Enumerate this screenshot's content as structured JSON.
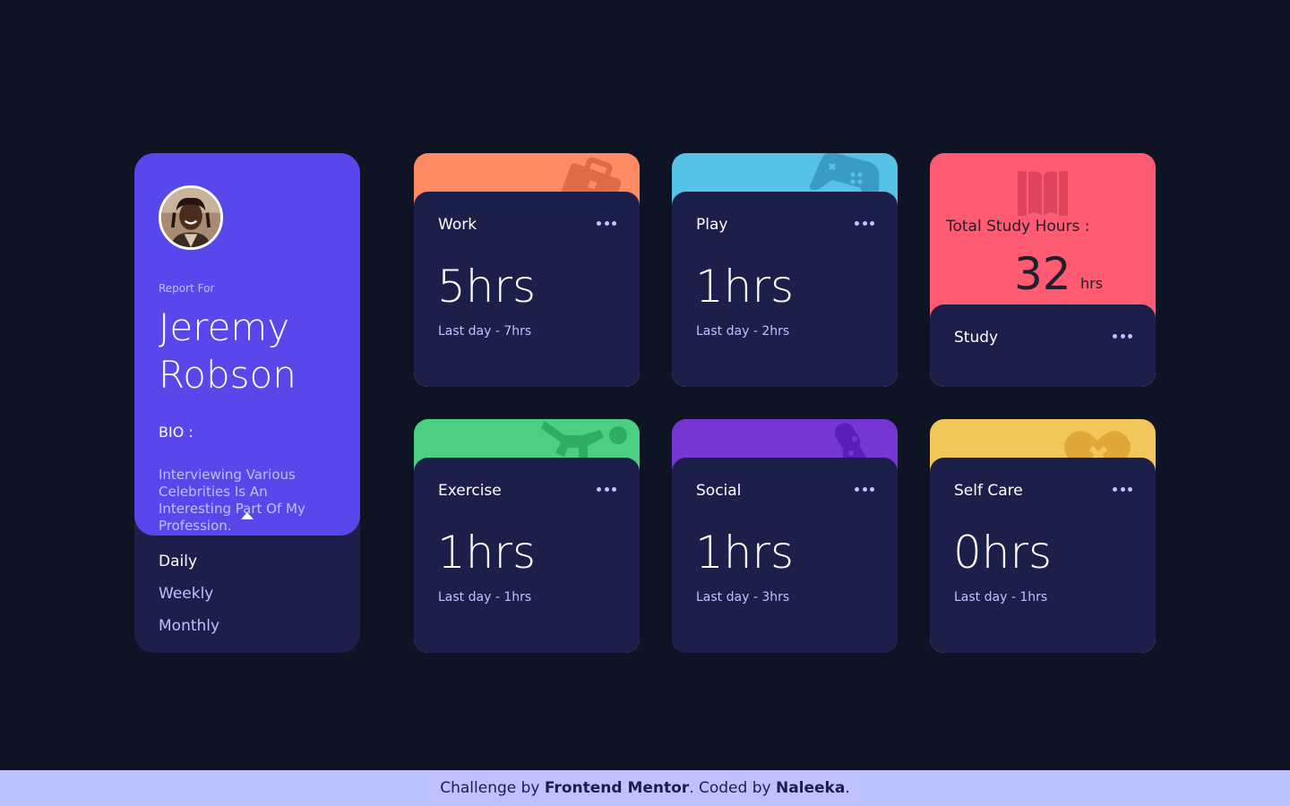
{
  "profile": {
    "report_for": "Report For",
    "name_line1": "Jeremy",
    "name_line2": "Robson",
    "bio_label": "BIO :",
    "bio_text": "Interviewing Various Celebrities Is An Interesting Part Of My Profession.",
    "timeframes": [
      "Daily",
      "Weekly",
      "Monthly"
    ],
    "active_timeframe": "Daily"
  },
  "activities": [
    {
      "title": "Work",
      "hours": "5hrs",
      "last": "Last day - 7hrs",
      "color": "#ff8b64",
      "icon": "briefcase-icon"
    },
    {
      "title": "Play",
      "hours": "1hrs",
      "last": "Last day - 2hrs",
      "color": "#55c2e6",
      "icon": "gamepad-icon"
    },
    {
      "title": "Exercise",
      "hours": "1hrs",
      "last": "Last day - 1hrs",
      "color": "#4bcf82",
      "icon": "runner-icon"
    },
    {
      "title": "Social",
      "hours": "1hrs",
      "last": "Last day - 3hrs",
      "color": "#7536d3",
      "icon": "social-icon"
    },
    {
      "title": "Self Care",
      "hours": "0hrs",
      "last": "Last day - 1hrs",
      "color": "#f1c75b",
      "icon": "heart-icon"
    }
  ],
  "study": {
    "total_label": "Total Study Hours :",
    "total_value": "32",
    "total_unit": "hrs",
    "title": "Study",
    "color": "#ff5b73",
    "icon": "book-icon"
  },
  "footer": {
    "prefix": "Challenge by ",
    "brand": "Frontend Mentor",
    "middle": ". Coded by ",
    "author": "Naleeka",
    "suffix": "."
  },
  "colors": {
    "background": "#0f1424",
    "card_panel": "#1c1f4a",
    "profile": "#5847eb",
    "pale_blue": "#bdc1ff"
  }
}
